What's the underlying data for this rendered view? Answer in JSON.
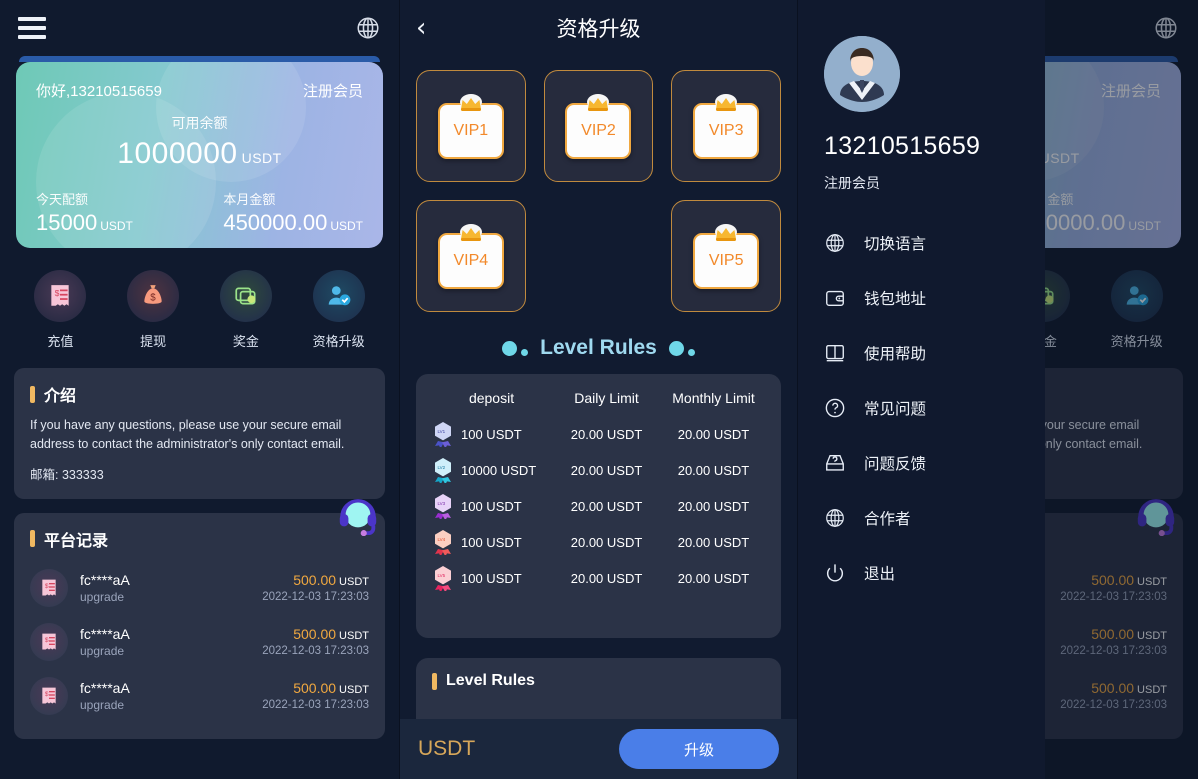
{
  "home": {
    "menu_icon": "hamburger-icon",
    "language_icon": "globe-icon",
    "greeting": "你好,13210515659",
    "member_tag": "注册会员",
    "balance_label": "可用余额",
    "balance_value": "1000000",
    "balance_unit": "USDT",
    "today_label": "今天配额",
    "today_value": "15000",
    "today_unit": "USDT",
    "month_label": "本月金额",
    "month_value": "450000.00",
    "month_unit": "USDT",
    "actions": [
      {
        "label": "充值",
        "icon": "receipt-deposit-icon"
      },
      {
        "label": "提现",
        "icon": "money-bag-icon"
      },
      {
        "label": "奖金",
        "icon": "exchange-bonus-icon"
      },
      {
        "label": "资格升级",
        "icon": "user-verified-icon"
      }
    ],
    "intro": {
      "title": "介绍",
      "body": "If you have any questions, please use your secure email address to contact the administrator's only contact email.",
      "mail": "邮箱: 333333"
    },
    "records": {
      "title": "平台记录",
      "rows": [
        {
          "name": "fc****aA",
          "type": "upgrade",
          "amount": "500.00",
          "unit": "USDT",
          "time": "2022-12-03 17:23:03"
        },
        {
          "name": "fc****aA",
          "type": "upgrade",
          "amount": "500.00",
          "unit": "USDT",
          "time": "2022-12-03 17:23:03"
        },
        {
          "name": "fc****aA",
          "type": "upgrade",
          "amount": "500.00",
          "unit": "USDT",
          "time": "2022-12-03 17:23:03"
        }
      ]
    },
    "support_icon": "headset-support-icon"
  },
  "vip": {
    "back_icon": "chevron-left-icon",
    "title": "资格升级",
    "tiles": [
      "VIP1",
      "VIP2",
      "VIP3",
      "VIP4",
      "VIP5"
    ],
    "rules_heading": "Level Rules",
    "table": {
      "headers": [
        "deposit",
        "Daily Limit",
        "Monthly Limit"
      ],
      "rows": [
        {
          "badge": "lv1-badge-icon",
          "deposit": "100 USDT",
          "daily": "20.00 USDT",
          "monthly": "20.00 USDT"
        },
        {
          "badge": "lv2-badge-icon",
          "deposit": "10000 USDT",
          "daily": "20.00 USDT",
          "monthly": "20.00 USDT"
        },
        {
          "badge": "lv3-badge-icon",
          "deposit": "100 USDT",
          "daily": "20.00 USDT",
          "monthly": "20.00 USDT"
        },
        {
          "badge": "lv4-badge-icon",
          "deposit": "100 USDT",
          "daily": "20.00 USDT",
          "monthly": "20.00 USDT"
        },
        {
          "badge": "lv5-badge-icon",
          "deposit": "100 USDT",
          "daily": "20.00 USDT",
          "monthly": "20.00 USDT"
        }
      ]
    },
    "rules_card_title": "Level Rules",
    "bottom_unit": "USDT",
    "upgrade_button": "升级"
  },
  "drawer": {
    "avatar_icon": "user-avatar-icon",
    "phone": "13210515659",
    "role": "注册会员",
    "items": [
      {
        "label": "切换语言",
        "icon": "globe-icon"
      },
      {
        "label": "钱包地址",
        "icon": "wallet-icon"
      },
      {
        "label": "使用帮助",
        "icon": "book-icon"
      },
      {
        "label": "常见问题",
        "icon": "question-circle-icon"
      },
      {
        "label": "问题反馈",
        "icon": "feedback-inbox-icon"
      },
      {
        "label": "合作者",
        "icon": "globe-icon"
      },
      {
        "label": "退出",
        "icon": "power-icon"
      }
    ]
  },
  "colors": {
    "accent_orange": "#f0a840",
    "accent_blue": "#4a7ee8",
    "card_bg": "#2b3347",
    "page_bg": "#101a2e",
    "cyan": "#6fd7e8"
  }
}
